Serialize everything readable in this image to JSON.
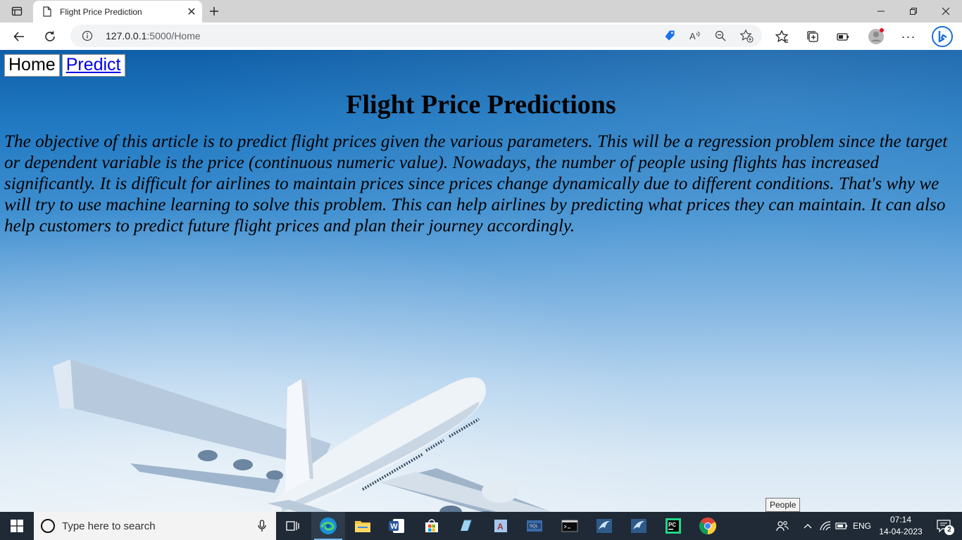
{
  "browser": {
    "tab_title": "Flight Price Prediction",
    "url_host": "127.0.0.1",
    "url_rest": ":5000/Home"
  },
  "page": {
    "nav": {
      "home": "Home",
      "predict": "Predict"
    },
    "heading": "Flight Price Predictions",
    "article": "The objective of this article is to predict flight prices given the various parameters. This will be a regression problem since the target or dependent variable is the price (continuous numeric value). Nowadays, the number of people using flights has increased significantly. It is difficult for airlines to maintain prices since prices change dynamically due to different conditions. That's why we will try to use machine learning to solve this problem. This can help airlines by predicting what prices they can maintain. It can also help customers to predict future flight prices and plan their journey accordingly."
  },
  "taskbar": {
    "search_placeholder": "Type here to search",
    "language": "ENG",
    "time": "07:14",
    "date": "14-04-2023",
    "notifications": "2",
    "tooltip": "People",
    "apps": [
      "edge-icon",
      "file-explorer-icon",
      "word-icon",
      "store-icon",
      "notepad-icon",
      "access-icon",
      "sql-icon",
      "terminal-icon",
      "mysql-workbench-icon",
      "mysql-workbench-icon",
      "pycharm-icon",
      "chrome-icon"
    ]
  },
  "colors": {
    "link": "#0000ee",
    "taskbar": "#1f2a36",
    "sky_top": "#0f5fa8",
    "sky_bottom": "#e4eef6"
  }
}
